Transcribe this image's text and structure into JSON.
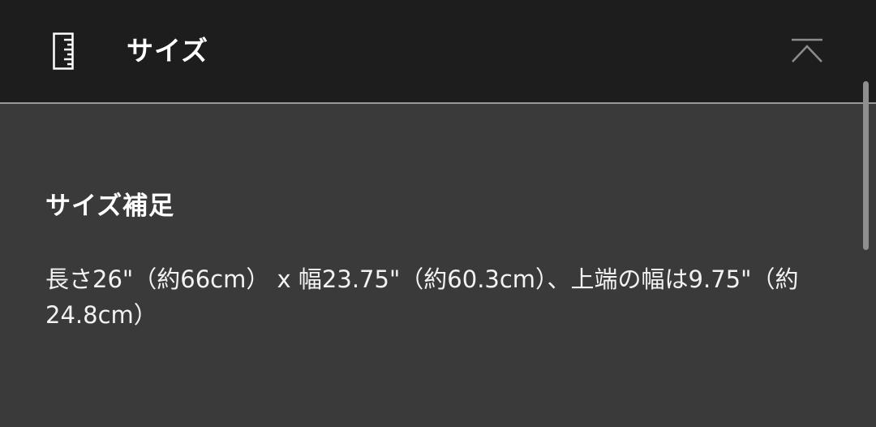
{
  "header": {
    "icon": "ruler-icon",
    "title": "サイズ",
    "collapse_icon": "chevron-up-icon"
  },
  "section": {
    "heading": "サイズ補足",
    "body": "長さ26\"（約66cm） x 幅23.75\"（約60.3cm）、上端の幅は9.75\"（約24.8cm）"
  },
  "colors": {
    "header_background": "#1d1d1d",
    "content_background": "#3a3a3a",
    "text": "#ffffff"
  }
}
